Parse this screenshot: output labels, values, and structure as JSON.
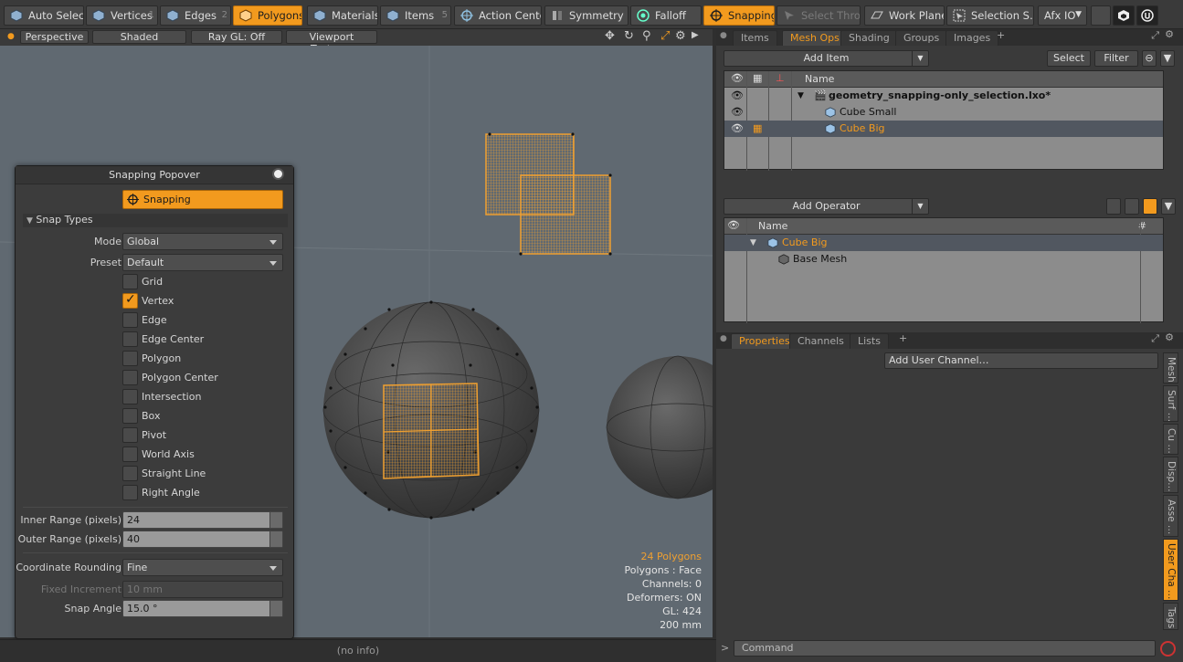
{
  "toolbar": {
    "auto_select": "Auto Select",
    "vertices": "Vertices",
    "vertices_num": "1",
    "edges": "Edges",
    "edges_num": "2",
    "polygons": "Polygons",
    "polygons_num": "3",
    "materials": "Materials",
    "items": "Items",
    "items_num": "5",
    "action_center": "Action Center",
    "symmetry": "Symmetry",
    "falloff": "Falloff",
    "snapping": "Snapping",
    "select_through": "Select Thro…",
    "work_plane": "Work Plane",
    "selection_sets": "Selection S…",
    "afx_io": "Afx IO"
  },
  "viewport": {
    "perspective": "Perspective",
    "shaded": "Shaded",
    "raygl": "Ray GL: Off",
    "textures": "Viewport Textures",
    "info": {
      "polygons": "24 Polygons",
      "mode": "Polygons : Face",
      "channels": "Channels: 0",
      "deformers": "Deformers: ON",
      "gl": "GL: 424",
      "size": "200 mm"
    }
  },
  "popover": {
    "title": "Snapping Popover",
    "snapping_btn": "Snapping",
    "snap_types": "Snap Types",
    "mode_label": "Mode",
    "mode_value": "Global",
    "preset_label": "Preset",
    "preset_value": "Default",
    "types": [
      "Grid",
      "Vertex",
      "Edge",
      "Edge Center",
      "Polygon",
      "Polygon Center",
      "Intersection",
      "Box",
      "Pivot",
      "World Axis",
      "Straight Line",
      "Right Angle"
    ],
    "inner_label": "Inner Range (pixels)",
    "inner_value": "24",
    "outer_label": "Outer Range (pixels)",
    "outer_value": "40",
    "rounding_label": "Coordinate Rounding",
    "rounding_value": "Fine",
    "fixed_label": "Fixed Increment",
    "fixed_value": "10 mm",
    "angle_label": "Snap Angle",
    "angle_value": "15.0 °"
  },
  "items_panel": {
    "tabs": [
      "Items",
      "Mesh Ops",
      "Shading",
      "Groups",
      "Images",
      "+"
    ],
    "add_item": "Add Item",
    "select": "Select",
    "filter": "Filter",
    "name_col": "Name",
    "rows": [
      "geometry_snapping-only_selection.lxo*",
      "Cube Small",
      "Cube Big"
    ]
  },
  "operator_panel": {
    "add_operator": "Add Operator",
    "name_col": "Name",
    "hash_col": "#",
    "rows": [
      "Cube Big",
      "Base Mesh"
    ]
  },
  "properties_panel": {
    "tabs": [
      "Properties",
      "Channels",
      "Lists",
      "+"
    ],
    "add_user_channel": "Add User Channel…",
    "side_tabs": [
      "Mesh",
      "Surf …",
      "Cu …",
      "Disp…",
      "Asse …",
      "User Cha …",
      "Tags"
    ]
  },
  "status": {
    "info": "(no info)",
    "command_placeholder": "Command",
    "prompt": ">"
  },
  "colors": {
    "accent": "#f29a1e",
    "viewport": "#606971"
  }
}
